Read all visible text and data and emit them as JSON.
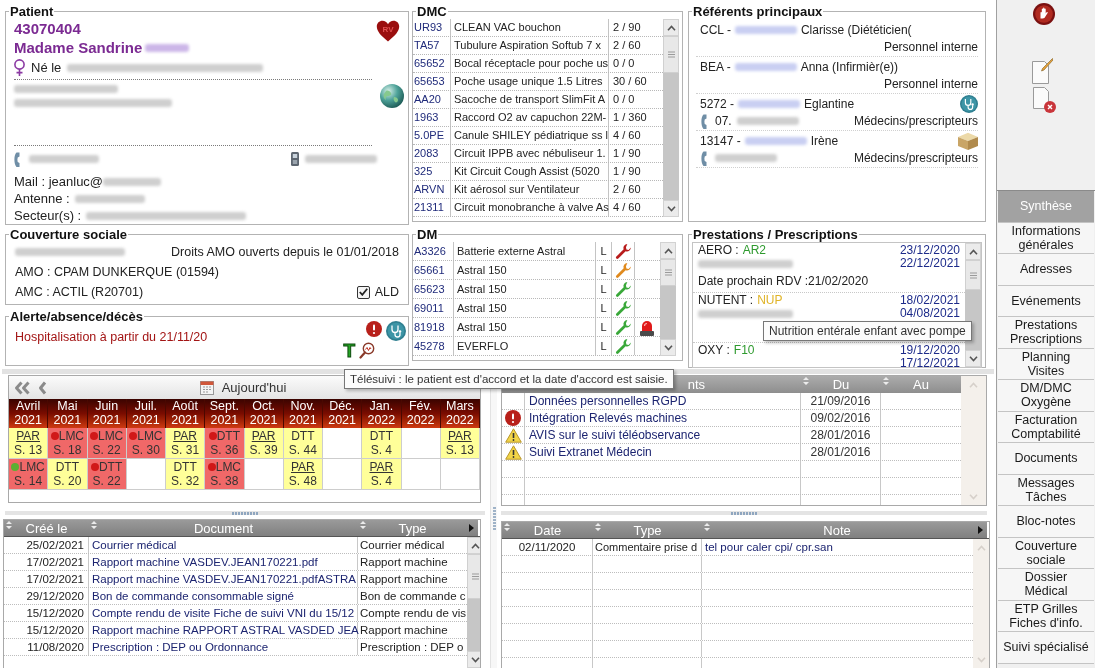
{
  "patient": {
    "title": "Patient",
    "number": "43070404",
    "name": "Madame Sandrine",
    "heart_badge": "RV",
    "birth_label": "Né le",
    "mail": "Mail : jeanluc@",
    "antenna": "Antenne :",
    "sectors": "Secteur(s) :"
  },
  "dmc": {
    "title": "DMC",
    "rows": [
      {
        "code": "UR93",
        "name": "CLEAN VAC bouchon",
        "quantity": "2 / 90"
      },
      {
        "code": "TA57",
        "name": "Tubulure Aspiration Softub 7 x",
        "quantity": "2 / 60"
      },
      {
        "code": "65652",
        "name": "Bocal réceptacle pour poche us",
        "quantity": "0 / 0"
      },
      {
        "code": "65653",
        "name": "Poche usage unique 1.5 Litres",
        "quantity": "30 / 60"
      },
      {
        "code": "AA20",
        "name": "Sacoche de transport SlimFit A",
        "quantity": "0 / 0"
      },
      {
        "code": "1963",
        "name": "Raccord O2 av capuchon 22M-",
        "quantity": "1 / 360"
      },
      {
        "code": "5.0PE",
        "name": "Canule SHILEY pédiatrique ss l",
        "quantity": "4 / 60"
      },
      {
        "code": "2083",
        "name": "Circuit IPPB avec nébuliseur 1.",
        "quantity": "1 / 90"
      },
      {
        "code": "325",
        "name": "Kit Circuit Cough Assist (5020",
        "quantity": "1 / 90"
      },
      {
        "code": "ARVN",
        "name": "Kit aérosol sur Ventilateur",
        "quantity": "2 / 60"
      },
      {
        "code": "21311",
        "name": "Circuit monobranche à valve As",
        "quantity": "4 / 60"
      }
    ]
  },
  "referents": {
    "title": "Référents principaux",
    "items": [
      {
        "code": "CCL -",
        "name": "Clarisse (Diététicien(",
        "kind": "staff",
        "phone": false,
        "category": "Personnel interne"
      },
      {
        "code": "BEA -",
        "name": "Anna (Infirmièr(e))",
        "kind": "staff",
        "phone": false,
        "category": "Personnel interne"
      },
      {
        "code": "5272 -",
        "name": "Eglantine",
        "kind": "doctor",
        "phone": true,
        "phone_prefix": "07.",
        "category": "Médecins/prescripteurs"
      },
      {
        "code": "13147 -",
        "name": "Irène",
        "kind": "provider",
        "phone": true,
        "category": "Médecins/prescripteurs"
      }
    ]
  },
  "coverage": {
    "title": "Couverture sociale",
    "rights": "Droits AMO ouverts depuis le 01/01/2018",
    "amo": "AMO : CPAM DUNKERQUE (01594)",
    "amc": "AMC : ACTIL (R20701)",
    "ald": {
      "label": "ALD",
      "checked": true
    }
  },
  "alert": {
    "title": "Alerte/absence/décès",
    "message": "Hospitalisation à partir du 21/11/20",
    "badge": "T"
  },
  "dm": {
    "title": "DM",
    "rows": [
      {
        "code": "A3326",
        "name": "Batterie externe Astral",
        "type": "L",
        "color": "#b81c1c",
        "alarm": false
      },
      {
        "code": "65661",
        "name": "Astral 150",
        "type": "L",
        "color": "#e08a1e",
        "alarm": false
      },
      {
        "code": "65623",
        "name": "Astral 150",
        "type": "L",
        "color": "#3aa83a",
        "alarm": false
      },
      {
        "code": "69011",
        "name": "Astral 150",
        "type": "L",
        "color": "#3aa83a",
        "alarm": false
      },
      {
        "code": "81918",
        "name": "Astral 150",
        "type": "L",
        "color": "#3aa83a",
        "alarm": true
      },
      {
        "code": "45278",
        "name": "EVERFLO",
        "type": "L",
        "color": "#3aa83a",
        "alarm": false
      }
    ]
  },
  "prescriptions": {
    "title": "Prestations / Prescriptions",
    "items": [
      {
        "label": "AERO :",
        "code": "AR2",
        "color": "#2e9a2e",
        "start": "23/12/2020",
        "end": "22/12/2021",
        "blurred_line": true,
        "next_visit": "Date prochain RDV :21/02/2020"
      },
      {
        "label": "NUTENT :",
        "code": "NUP",
        "color": "#e0b428",
        "start": "18/02/2021",
        "end": "04/08/2021",
        "blurred_line": true
      },
      {
        "label": "OXY :",
        "code": "F10",
        "color": "#2e9a2e",
        "start": "19/12/2020",
        "end": "17/12/2021",
        "blurred_line": false
      }
    ],
    "tooltip": "Nutrition entérale enfant avec pompe"
  },
  "calendar": {
    "today": "Aujourd'hui",
    "tooltip": "Télésuivi : le patient est d'accord et la date d'accord est saisie.",
    "months": [
      {
        "month": "Avril",
        "year": "2021",
        "visits": [
          {
            "code": "PAR",
            "week": "S. 13",
            "color": "#ffff99",
            "link": true
          },
          {
            "code": "LMC",
            "week": "S. 14",
            "color": "#f06868",
            "link": false,
            "dot": {
              "color": "#5cb032"
            }
          }
        ]
      },
      {
        "month": "Mai",
        "year": "2021",
        "visits": [
          {
            "code": "LMC",
            "week": "S. 18",
            "color": "#f06868",
            "link": false,
            "dot": {
              "color": "#d01818"
            }
          },
          {
            "code": "DTT",
            "week": "S. 20",
            "color": "#ffff99",
            "link": false
          }
        ]
      },
      {
        "month": "Juin",
        "year": "2021",
        "visits": [
          {
            "code": "LMC",
            "week": "S. 22",
            "color": "#f06868",
            "link": false,
            "dot": {
              "color": "#d01818"
            }
          },
          {
            "code": "DTT",
            "week": "S. 22",
            "color": "#f06868",
            "link": false,
            "dot": {
              "color": "#d01818"
            }
          }
        ]
      },
      {
        "month": "Juil.",
        "year": "2021",
        "visits": [
          {
            "code": "LMC",
            "week": "S. 30",
            "color": "#f06868",
            "link": false,
            "dot": {
              "color": "#d01818"
            }
          }
        ]
      },
      {
        "month": "Août",
        "year": "2021",
        "visits": [
          {
            "code": "PAR",
            "week": "S. 31",
            "color": "#ffff99",
            "link": true
          },
          {
            "code": "DTT",
            "week": "S. 32",
            "color": "#ffff99",
            "link": false
          }
        ]
      },
      {
        "month": "Sept.",
        "year": "2021",
        "visits": [
          {
            "code": "DTT",
            "week": "S. 36",
            "color": "#f06868",
            "link": false,
            "dot": {
              "color": "#d01818"
            }
          },
          {
            "code": "LMC",
            "week": "S. 38",
            "color": "#f06868",
            "link": false,
            "dot": {
              "color": "#d01818"
            }
          }
        ]
      },
      {
        "month": "Oct.",
        "year": "2021",
        "visits": [
          {
            "code": "PAR",
            "week": "S. 39",
            "color": "#ffff99",
            "link": true
          }
        ]
      },
      {
        "month": "Nov.",
        "year": "2021",
        "visits": [
          {
            "code": "DTT",
            "week": "S. 44",
            "color": "#ffff99",
            "link": false
          },
          {
            "code": "PAR",
            "week": "S. 48",
            "color": "#ffff99",
            "link": true
          }
        ]
      },
      {
        "month": "Déc.",
        "year": "2021"
      },
      {
        "month": "Jan.",
        "year": "2022",
        "visits": [
          {
            "code": "DTT",
            "week": "S. 4",
            "color": "#ffff99",
            "link": false
          },
          {
            "code": "PAR",
            "week": "S. 4",
            "color": "#ffff99",
            "link": true
          }
        ]
      },
      {
        "month": "Fév.",
        "year": "2022"
      },
      {
        "month": "Mars",
        "year": "2022",
        "visits": [
          {
            "code": "PAR",
            "week": "S. 13",
            "color": "#ffff99",
            "link": true
          }
        ]
      }
    ]
  },
  "events": {
    "columns": [
      {
        "label": "nts",
        "sortable": false
      },
      {
        "label": "Du",
        "sortable": true
      },
      {
        "label": "Au",
        "sortable": true
      }
    ],
    "rows": [
      {
        "kind": "plain",
        "label": "Données personnelles RGPD",
        "from": "21/09/2016"
      },
      {
        "kind": "error",
        "label": "Intégration Relevés machines",
        "from": "09/02/2016"
      },
      {
        "kind": "warning",
        "label": "AVIS sur le suivi téléobservance",
        "from": "28/01/2016"
      },
      {
        "kind": "warning",
        "label": "Suivi Extranet Médecin",
        "from": "28/01/2016"
      }
    ]
  },
  "documents": {
    "columns": [
      {
        "label": "Créé le",
        "sortable": true
      },
      {
        "label": "Document",
        "sortable": true
      },
      {
        "label": "Type",
        "sortable": true
      }
    ],
    "rows": [
      {
        "created": "25/02/2021",
        "document": "Courrier médical",
        "type": "Courrier médical"
      },
      {
        "created": "17/02/2021",
        "document": "Rapport machine VASDEV.JEAN170221.pdf",
        "type": "Rapport machine"
      },
      {
        "created": "17/02/2021",
        "document": "Rapport machine VASDEV.JEAN170221.pdfASTRA",
        "type": "Rapport machine"
      },
      {
        "created": "29/12/2020",
        "document": "Bon de commande consommable signé",
        "type": "Bon de commande c"
      },
      {
        "created": "15/12/2020",
        "document": "Compte rendu de visite Fiche de suivi VNI du 15/12",
        "type": "Compte rendu de vis"
      },
      {
        "created": "15/12/2020",
        "document": "Rapport machine RAPPORT ASTRAL VASDED JEA",
        "type": "Rapport machine"
      },
      {
        "created": "11/08/2020",
        "document": "Prescription : DEP ou Ordonnance",
        "type": "Prescription : DEP o"
      }
    ]
  },
  "notes": {
    "columns": [
      {
        "label": "Date",
        "sortable": true
      },
      {
        "label": "Type",
        "sortable": true
      },
      {
        "label": "Note",
        "sortable": true
      }
    ],
    "rows": [
      {
        "date": "02/11/2020",
        "type": "Commentaire prise d",
        "note": "tel pour caler cpi/ cpr.san"
      }
    ]
  },
  "sidebar": {
    "items": [
      {
        "label": "Synthèse",
        "selected": true
      },
      {
        "label": "Informations\ngénérales",
        "selected": false
      },
      {
        "label": "Adresses",
        "selected": false
      },
      {
        "label": "Evénements",
        "selected": false
      },
      {
        "label": "Prestations\nPrescriptions",
        "selected": false
      },
      {
        "label": "Planning\nVisites",
        "selected": false
      },
      {
        "label": "DM/DMC\nOxygène",
        "selected": false
      },
      {
        "label": "Facturation\nComptabilité",
        "selected": false
      },
      {
        "label": "Documents",
        "selected": false
      },
      {
        "label": "Messages\nTâches",
        "selected": false
      },
      {
        "label": "Bloc-notes",
        "selected": false
      },
      {
        "label": "Couverture\nsociale",
        "selected": false
      },
      {
        "label": "Dossier\nMédical",
        "selected": false
      },
      {
        "label": "ETP Grilles\nFiches d'info.",
        "selected": false
      },
      {
        "label": "Suivi spécialisé",
        "selected": false
      }
    ]
  }
}
